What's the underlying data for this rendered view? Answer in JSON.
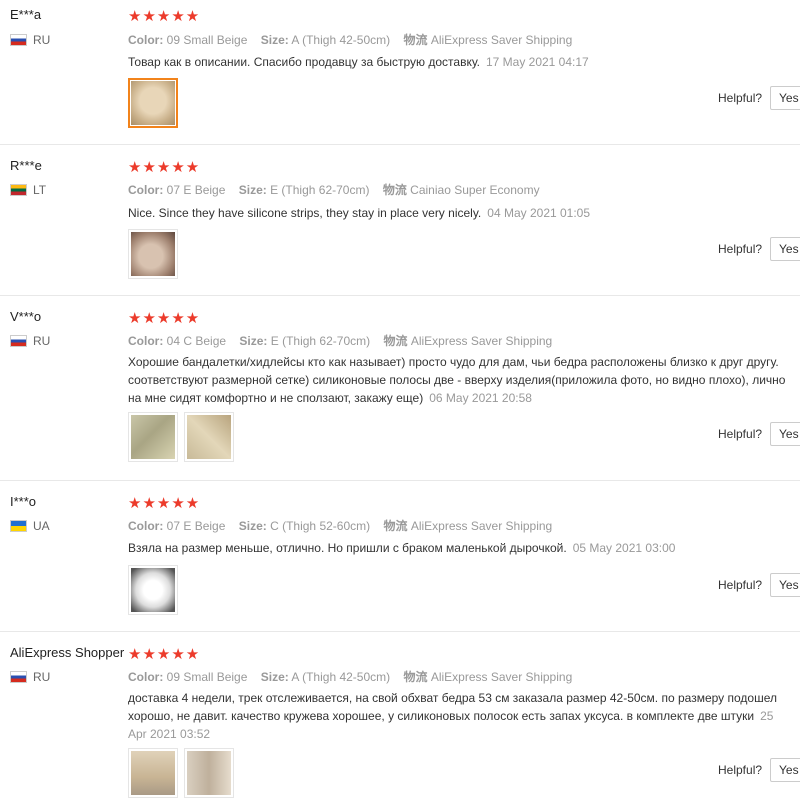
{
  "labels": {
    "color": "Color:",
    "size": "Size:",
    "shipping": "物流",
    "helpful": "Helpful?",
    "yes": "Yes"
  },
  "rating_stars": "★★★★★",
  "reviews": [
    {
      "user": "E***a",
      "country": "RU",
      "rating": 5,
      "color": "09 Small Beige",
      "size": "A (Thigh 42-50cm)",
      "shipping": "AliExpress Saver Shipping",
      "text": "Товар как в описании. Спасибо продавцу за быструю доставку.",
      "date": "17 May 2021 04:17",
      "thumbs": [
        "photo"
      ]
    },
    {
      "user": "R***e",
      "country": "LT",
      "rating": 5,
      "color": "07 E Beige",
      "size": "E (Thigh 62-70cm)",
      "shipping": "Cainiao Super Economy",
      "text": "Nice. Since they have silicone strips, they stay in place very nicely.",
      "date": "04 May 2021 01:05",
      "thumbs": [
        "photo"
      ]
    },
    {
      "user": "V***o",
      "country": "RU",
      "rating": 5,
      "color": "04 C Beige",
      "size": "E (Thigh 62-70cm)",
      "shipping": "AliExpress Saver Shipping",
      "text": "Хорошие бандалетки/хидлейсы кто как называет) просто чудо для дам, чьи бедра расположены близко к друг другу. соответствуют размерной сетке) силиконовые полосы две - вверху изделия(приложила фото, но видно плохо), лично на мне сидят комфортно и не сползают, закажу еще)",
      "date": "06 May 2021 20:58",
      "thumbs": [
        "photo",
        "photo"
      ]
    },
    {
      "user": "I***o",
      "country": "UA",
      "rating": 5,
      "color": "07 E Beige",
      "size": "C (Thigh 52-60cm)",
      "shipping": "AliExpress Saver Shipping",
      "text": "Взяла на размер меньше, отлично. Но пришли с браком маленькой дырочкой.",
      "date": "05 May 2021 03:00",
      "thumbs": [
        "photo"
      ]
    },
    {
      "user": "AliExpress Shopper",
      "country": "RU",
      "rating": 5,
      "color": "09 Small Beige",
      "size": "A (Thigh 42-50cm)",
      "shipping": "AliExpress Saver Shipping",
      "text": "доставка 4 недели, трек отслеживается, на свой обхват бедра 53 см заказала размер 42-50см. по размеру подошел хорошо, не давит. качество кружева хорошее, у силиконовых полосок есть запах уксуса. в комплекте две штуки",
      "date": "25 Apr 2021 03:52",
      "thumbs": [
        "photo",
        "photo"
      ]
    }
  ]
}
